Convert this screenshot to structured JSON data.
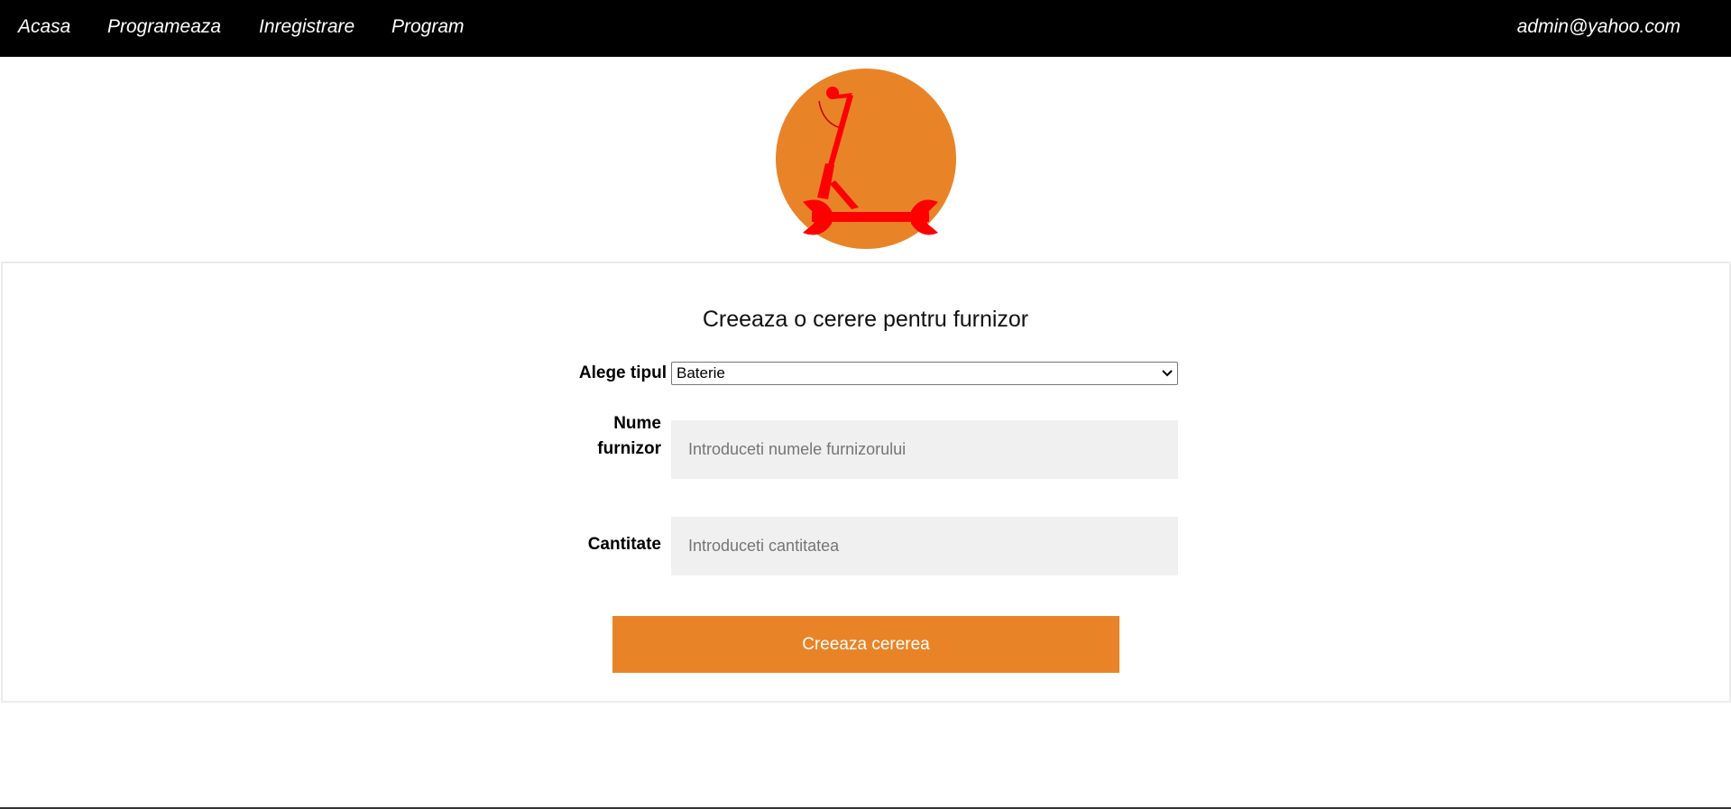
{
  "nav": {
    "links": [
      "Acasa",
      "Programeaza",
      "Inregistrare",
      "Program"
    ],
    "user_email": "admin@yahoo.com"
  },
  "logo": {
    "icon": "scooter-wrench-icon",
    "circle_color": "#e88427",
    "glyph_color": "#ff0000"
  },
  "form": {
    "title": "Creeaza o cerere pentru furnizor",
    "type_label": "Alege tipul",
    "type_value": "Baterie",
    "supplier_label_line1": "Nume",
    "supplier_label_line2": "furnizor",
    "supplier_placeholder": "Introduceti numele furnizorului",
    "quantity_label": "Cantitate",
    "quantity_placeholder": "Introduceti cantitatea",
    "submit_label": "Creeaza cererea"
  },
  "colors": {
    "nav_bg": "#000000",
    "accent": "#e88427",
    "input_bg": "#f0f0f0"
  }
}
